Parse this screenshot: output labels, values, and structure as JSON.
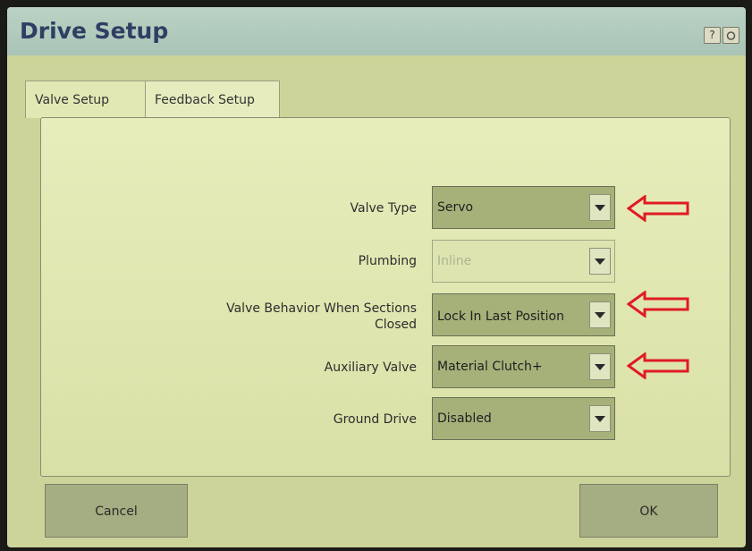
{
  "window": {
    "title": "Drive Setup",
    "help_icon": "?"
  },
  "tabs": [
    {
      "label": "Valve Setup",
      "active": true
    },
    {
      "label": "Feedback Setup",
      "active": false
    }
  ],
  "fields": [
    {
      "label": "Valve Type",
      "value": "Servo",
      "enabled": true,
      "highlighted": true
    },
    {
      "label": "Plumbing",
      "value": "Inline",
      "enabled": false,
      "highlighted": false
    },
    {
      "label_line1": "Valve Behavior When Sections",
      "label_line2": "Closed",
      "value": "Lock In Last Position",
      "enabled": true,
      "highlighted": true
    },
    {
      "label": "Auxiliary Valve",
      "value": "Material Clutch+",
      "enabled": true,
      "highlighted": true
    },
    {
      "label": "Ground Drive",
      "value": "Disabled",
      "enabled": true,
      "highlighted": false
    }
  ],
  "buttons": {
    "cancel": "Cancel",
    "ok": "OK"
  },
  "colors": {
    "annotation_arrow": "#e01b24",
    "title": "#2e3f63"
  }
}
